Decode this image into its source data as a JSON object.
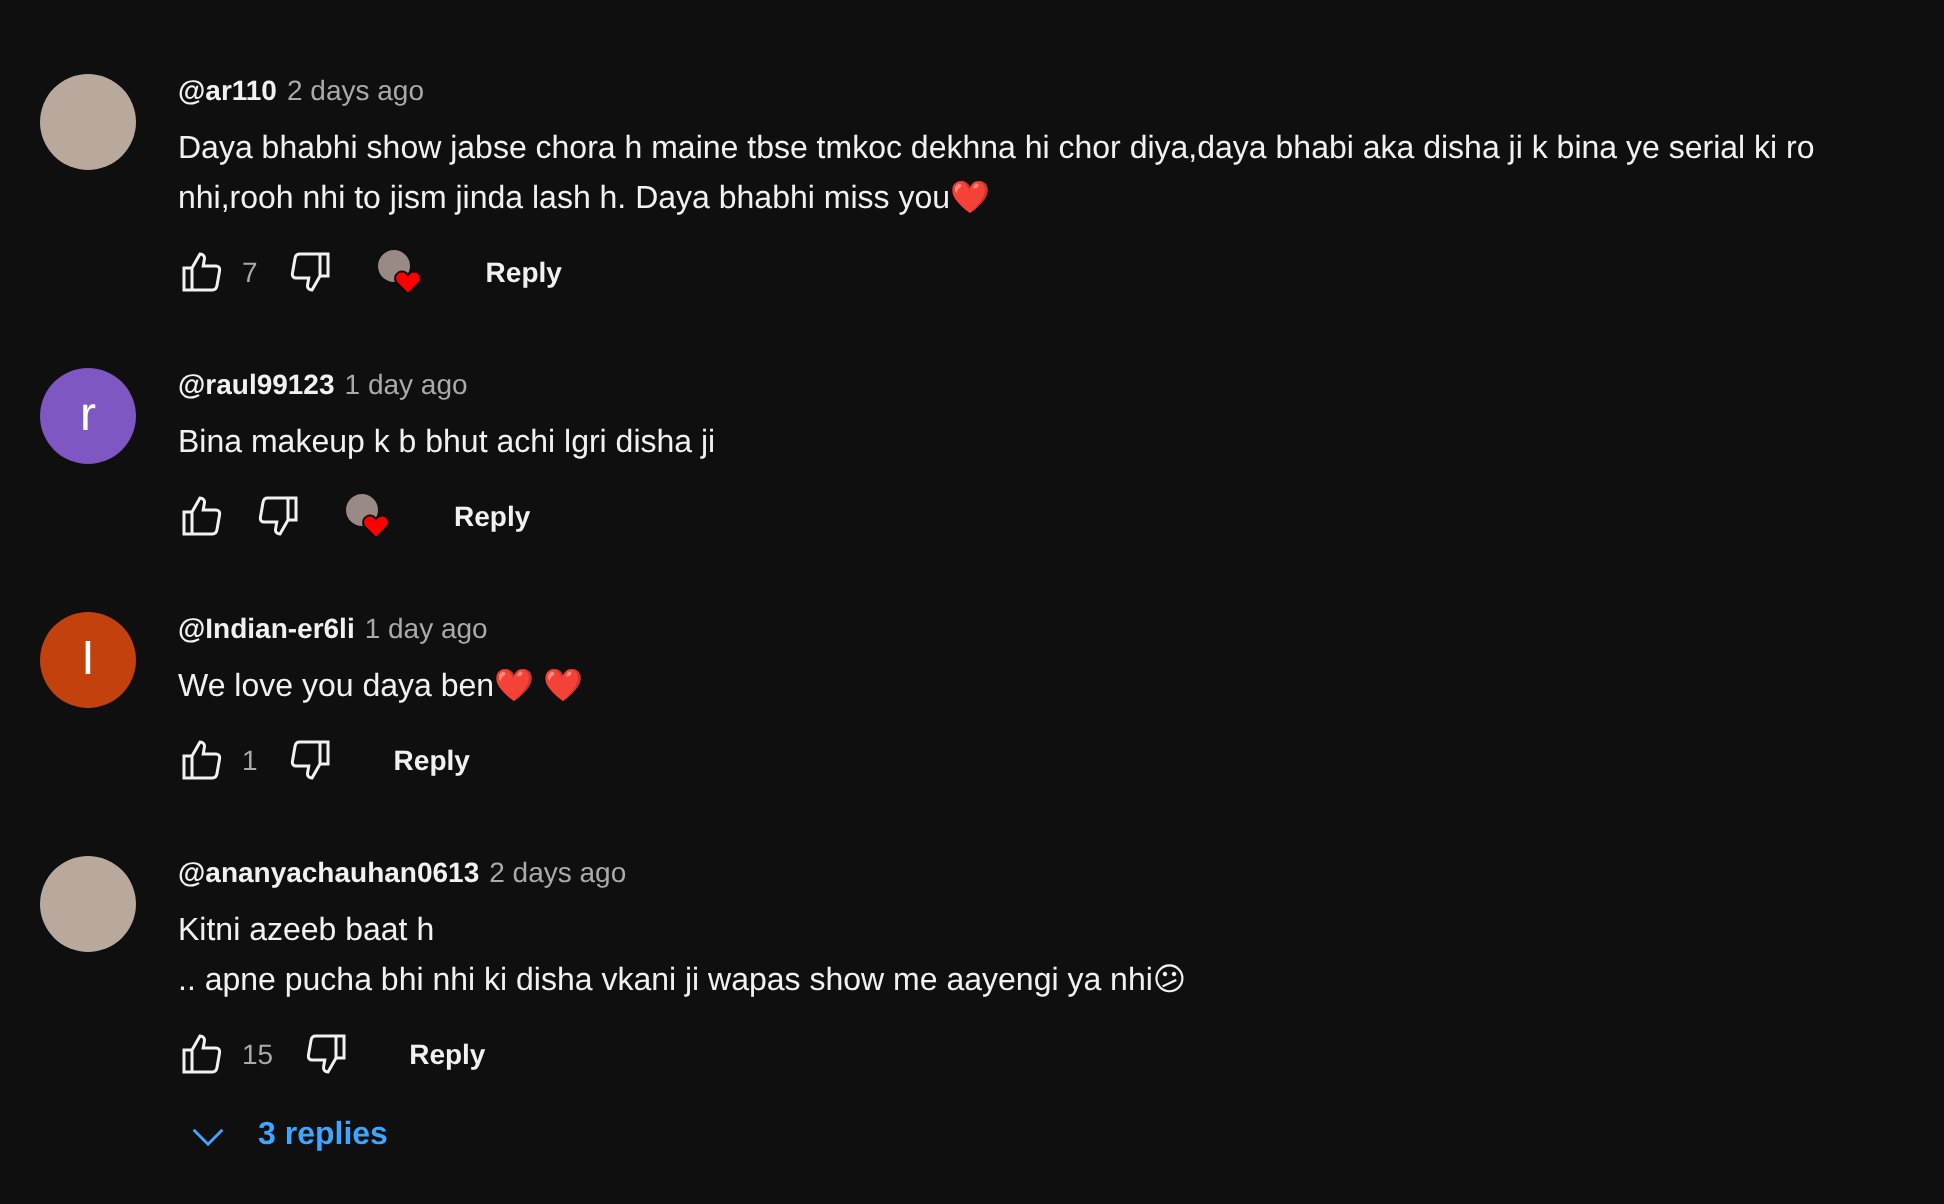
{
  "comments": [
    {
      "author": "@ar110",
      "time": "2 days ago",
      "avatar": {
        "kind": "photo"
      },
      "lines": [
        "Daya bhabhi show jabse chora h maine tbse tmkoc dekhna hi chor diya,daya bhabi aka disha ji k bina ye serial ki ro",
        "nhi,rooh nhi to jism jinda lash h. Daya bhabhi miss you❤️"
      ],
      "likes": "7",
      "hearted": true,
      "reply": "Reply"
    },
    {
      "author": "@raul99123",
      "time": "1 day ago",
      "avatar": {
        "kind": "letter",
        "letter": "r",
        "color": "#7e57c2"
      },
      "lines": [
        "Bina makeup k b bhut achi lgri disha ji"
      ],
      "hearted": true,
      "reply": "Reply"
    },
    {
      "author": "@Indian-er6li",
      "time": "1 day ago",
      "avatar": {
        "kind": "letter",
        "letter": "I",
        "color": "#c2410c"
      },
      "lines": [
        "We love you daya ben❤️ ❤️"
      ],
      "likes": "1",
      "hearted": false,
      "reply": "Reply"
    },
    {
      "author": "@ananyachauhan0613",
      "time": "2 days ago",
      "avatar": {
        "kind": "photo"
      },
      "lines": [
        "Kitni azeeb baat h",
        ".. apne pucha bhi nhi ki disha vkani ji wapas show me aayengi ya nhi😕"
      ],
      "likes": "15",
      "hearted": false,
      "reply": "Reply",
      "replies": "3 replies"
    }
  ]
}
